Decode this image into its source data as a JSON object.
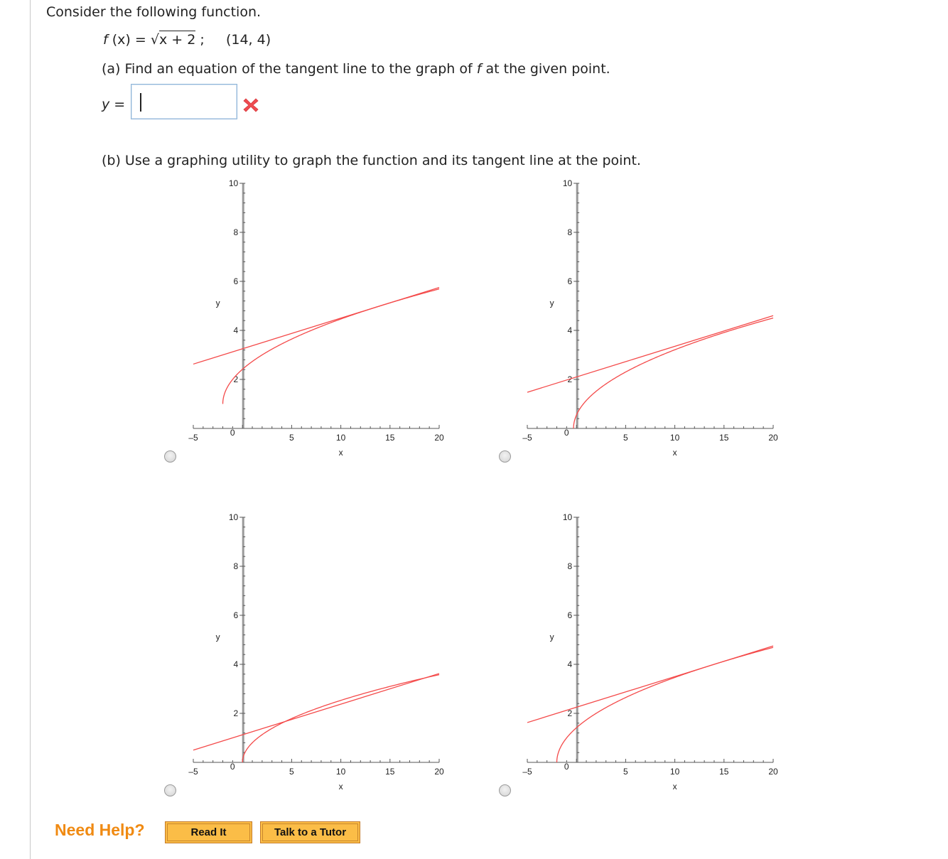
{
  "question": {
    "intro": "Consider the following function.",
    "function": {
      "name": "f",
      "arg": "(x)",
      "equals": "=",
      "radical_symbol": "√",
      "radicand": "x + 2",
      "terminator": ";",
      "point": "(14, 4)"
    },
    "part_a": {
      "prefix": "(a) Find an equation of the tangent line to the graph of",
      "fn_name": "f",
      "suffix": "at the given point."
    },
    "answer": {
      "label_var": "y",
      "label_eq": "=",
      "value": "",
      "status": "incorrect",
      "status_icon": "red-x-icon",
      "status_color": "#e8464a"
    },
    "part_b": {
      "text": "(b) Use a graphing utility to graph the function and its tangent line at the point."
    }
  },
  "help": {
    "label": "Need Help?",
    "buttons": [
      "Read It",
      "Talk to a Tutor"
    ],
    "accent": "#f08a12"
  },
  "chart_data": [
    {
      "type": "line",
      "option": 1,
      "selected": false,
      "xlabel": "x",
      "ylabel": "y",
      "xlim": [
        -5,
        20
      ],
      "ylim": [
        0,
        10
      ],
      "xticks": [
        "-5",
        "0",
        "5",
        "10",
        "15",
        "20"
      ],
      "yticks": [
        "2",
        "4",
        "6",
        "8",
        "10"
      ],
      "line_color": "#f44a4a",
      "series": [
        {
          "name": "function",
          "kind": "sqrt",
          "shift": 2,
          "vshift": 1.0,
          "x_start": -2
        },
        {
          "name": "tangent line",
          "kind": "linear",
          "slope": 0.125,
          "intercept": 3.25
        }
      ]
    },
    {
      "type": "line",
      "option": 2,
      "selected": false,
      "xlabel": "x",
      "ylabel": "y",
      "xlim": [
        -5,
        20
      ],
      "ylim": [
        0,
        10
      ],
      "xticks": [
        "-5",
        "0",
        "5",
        "10",
        "15",
        "20"
      ],
      "yticks": [
        "2",
        "4",
        "6",
        "8",
        "10"
      ],
      "line_color": "#f44a4a",
      "series": [
        {
          "name": "function",
          "kind": "sqrt",
          "shift": 0.3,
          "vshift": 0.0,
          "x_start": -0.3
        },
        {
          "name": "tangent line",
          "kind": "linear",
          "slope": 0.125,
          "intercept": 2.1
        }
      ]
    },
    {
      "type": "line",
      "option": 3,
      "selected": false,
      "xlabel": "x",
      "ylabel": "y",
      "xlim": [
        -5,
        20
      ],
      "ylim": [
        0,
        10
      ],
      "xticks": [
        "-5",
        "0",
        "5",
        "10",
        "15",
        "20"
      ],
      "yticks": [
        "2",
        "4",
        "6",
        "8",
        "10"
      ],
      "line_color": "#f44a4a",
      "series": [
        {
          "name": "function",
          "kind": "sqrt",
          "shift": 0,
          "vshift": 0.0,
          "x_start": 0,
          "scale": 0.8
        },
        {
          "name": "tangent line",
          "kind": "linear",
          "slope": 0.125,
          "intercept": 1.125
        }
      ]
    },
    {
      "type": "line",
      "option": 4,
      "selected": false,
      "xlabel": "x",
      "ylabel": "y",
      "xlim": [
        -5,
        20
      ],
      "ylim": [
        0,
        10
      ],
      "xticks": [
        "-5",
        "0",
        "5",
        "10",
        "15",
        "20"
      ],
      "yticks": [
        "2",
        "4",
        "6",
        "8",
        "10"
      ],
      "line_color": "#f44a4a",
      "series": [
        {
          "name": "function",
          "kind": "sqrt",
          "shift": 2,
          "vshift": 0.0,
          "x_start": -2
        },
        {
          "name": "tangent line",
          "kind": "linear",
          "slope": 0.125,
          "intercept": 2.25
        }
      ]
    }
  ]
}
